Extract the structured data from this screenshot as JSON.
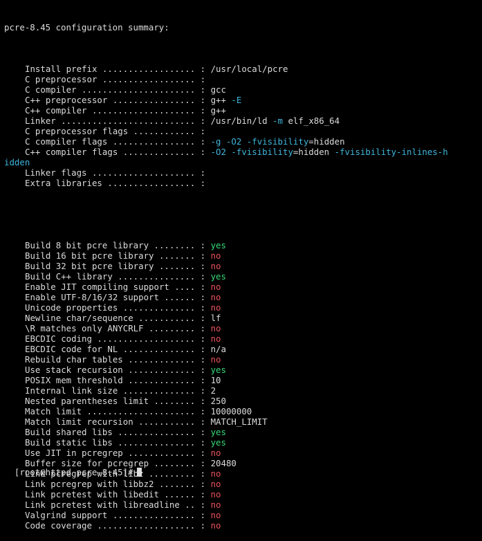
{
  "terminal": {
    "heading": "pcre-8.45 configuration summary:",
    "paths_section": [
      {
        "label": "Install prefix .................. :",
        "value": [
          {
            "t": "/usr/local/pcre",
            "c": "plain"
          }
        ]
      },
      {
        "label": "C preprocessor .................. :",
        "value": []
      },
      {
        "label": "C compiler ...................... :",
        "value": [
          {
            "t": "gcc",
            "c": "plain"
          }
        ]
      },
      {
        "label": "C++ preprocessor ................ :",
        "value": [
          {
            "t": "g++ ",
            "c": "plain"
          },
          {
            "t": "-E",
            "c": "cyan"
          }
        ]
      },
      {
        "label": "C++ compiler .................... :",
        "value": [
          {
            "t": "g++",
            "c": "plain"
          }
        ]
      },
      {
        "label": "Linker .......................... :",
        "value": [
          {
            "t": "/usr/bin/ld ",
            "c": "plain"
          },
          {
            "t": "-m",
            "c": "cyan"
          },
          {
            "t": " elf_x86_64",
            "c": "plain"
          }
        ]
      },
      {
        "label": "C preprocessor flags ............ :",
        "value": []
      },
      {
        "label": "C compiler flags ................ :",
        "value": [
          {
            "t": "-g -O2 -fvisibility",
            "c": "cyan"
          },
          {
            "t": "=hidden",
            "c": "plain"
          }
        ]
      },
      {
        "label": "C++ compiler flags .............. :",
        "value": [
          {
            "t": "-O2 -fvisibility",
            "c": "cyan"
          },
          {
            "t": "=hidden ",
            "c": "plain"
          },
          {
            "t": "-fvisibility-inlines-h",
            "c": "cyan"
          }
        ]
      },
      {
        "wrap": true,
        "value": [
          {
            "t": "idden",
            "c": "cyan"
          }
        ]
      },
      {
        "label": "Linker flags .................... :",
        "value": []
      },
      {
        "label": "Extra libraries ................. :",
        "value": []
      }
    ],
    "features_section": [
      {
        "label": "Build 8 bit pcre library ........ :",
        "value": [
          {
            "t": "yes",
            "c": "green"
          }
        ]
      },
      {
        "label": "Build 16 bit pcre library ....... :",
        "value": [
          {
            "t": "no",
            "c": "red"
          }
        ]
      },
      {
        "label": "Build 32 bit pcre library ....... :",
        "value": [
          {
            "t": "no",
            "c": "red"
          }
        ]
      },
      {
        "label": "Build C++ library ............... :",
        "value": [
          {
            "t": "yes",
            "c": "green"
          }
        ]
      },
      {
        "label": "Enable JIT compiling support .... :",
        "value": [
          {
            "t": "no",
            "c": "red"
          }
        ]
      },
      {
        "label": "Enable UTF-8/16/32 support ...... :",
        "value": [
          {
            "t": "no",
            "c": "red"
          }
        ]
      },
      {
        "label": "Unicode properties .............. :",
        "value": [
          {
            "t": "no",
            "c": "red"
          }
        ]
      },
      {
        "label": "Newline char/sequence ........... :",
        "value": [
          {
            "t": "lf",
            "c": "plain"
          }
        ]
      },
      {
        "label": "\\R matches only ANYCRLF ......... :",
        "value": [
          {
            "t": "no",
            "c": "red"
          }
        ]
      },
      {
        "label": "EBCDIC coding ................... :",
        "value": [
          {
            "t": "no",
            "c": "red"
          }
        ]
      },
      {
        "label": "EBCDIC code for NL .............. :",
        "value": [
          {
            "t": "n/a",
            "c": "plain"
          }
        ]
      },
      {
        "label": "Rebuild char tables ............. :",
        "value": [
          {
            "t": "no",
            "c": "red"
          }
        ]
      },
      {
        "label": "Use stack recursion ............. :",
        "value": [
          {
            "t": "yes",
            "c": "green"
          }
        ]
      },
      {
        "label": "POSIX mem threshold ............. :",
        "value": [
          {
            "t": "10",
            "c": "plain"
          }
        ]
      },
      {
        "label": "Internal link size .............. :",
        "value": [
          {
            "t": "2",
            "c": "plain"
          }
        ]
      },
      {
        "label": "Nested parentheses limit ........ :",
        "value": [
          {
            "t": "250",
            "c": "plain"
          }
        ]
      },
      {
        "label": "Match limit ..................... :",
        "value": [
          {
            "t": "10000000",
            "c": "plain"
          }
        ]
      },
      {
        "label": "Match limit recursion ........... :",
        "value": [
          {
            "t": "MATCH_LIMIT",
            "c": "plain"
          }
        ]
      },
      {
        "label": "Build shared libs ............... :",
        "value": [
          {
            "t": "yes",
            "c": "green"
          }
        ]
      },
      {
        "label": "Build static libs ............... :",
        "value": [
          {
            "t": "yes",
            "c": "green"
          }
        ]
      },
      {
        "label": "Use JIT in pcregrep ............. :",
        "value": [
          {
            "t": "no",
            "c": "red"
          }
        ]
      },
      {
        "label": "Buffer size for pcregrep ........ :",
        "value": [
          {
            "t": "20480",
            "c": "plain"
          }
        ]
      },
      {
        "label": "Link pcregrep with libz ......... :",
        "value": [
          {
            "t": "no",
            "c": "red"
          }
        ]
      },
      {
        "label": "Link pcregrep with libbz2 ....... :",
        "value": [
          {
            "t": "no",
            "c": "red"
          }
        ]
      },
      {
        "label": "Link pcretest with libedit ...... :",
        "value": [
          {
            "t": "no",
            "c": "red"
          }
        ]
      },
      {
        "label": "Link pcretest with libreadline .. :",
        "value": [
          {
            "t": "no",
            "c": "red"
          }
        ]
      },
      {
        "label": "Valgrind support ................ :",
        "value": [
          {
            "t": "no",
            "c": "red"
          }
        ]
      },
      {
        "label": "Code coverage ................... :",
        "value": [
          {
            "t": "no",
            "c": "red"
          }
        ]
      }
    ],
    "prompt": "[root@httpd pcre-8.45]#",
    "colors": {
      "background": "#000000",
      "text": "#dcdcdc",
      "flag": "#3fb6dc",
      "yes": "#38d878",
      "no": "#e8525a"
    }
  }
}
